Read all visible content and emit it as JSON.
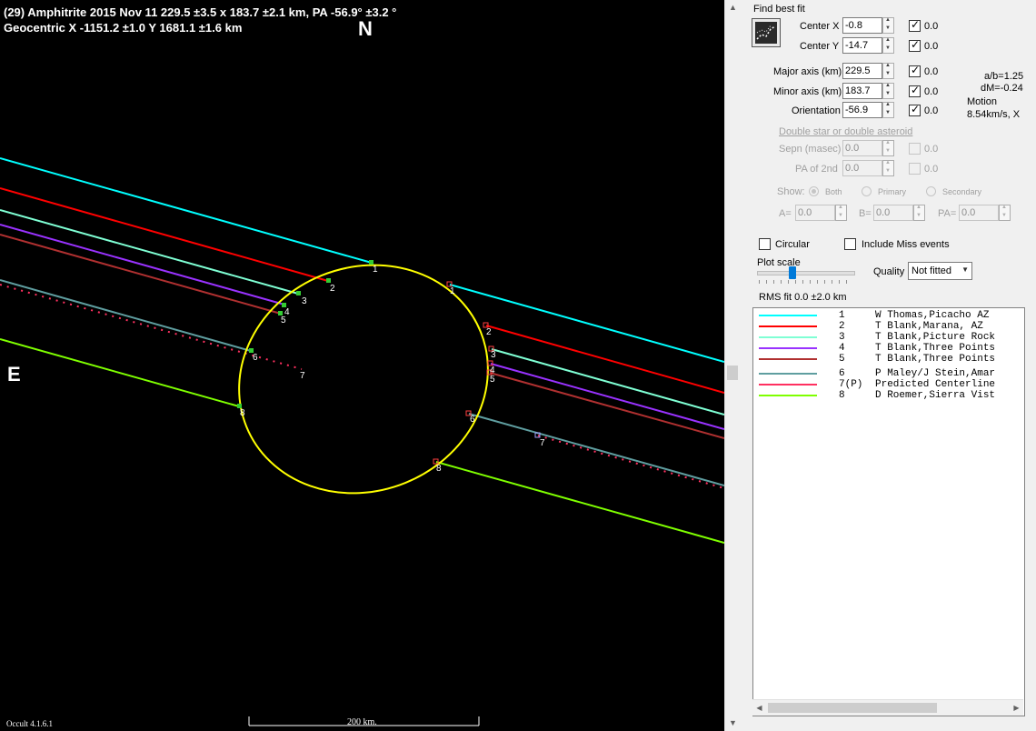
{
  "header": {
    "line1": "(29) Amphitrite  2015 Nov 11   229.5 ±3.5 x 183.7 ±2.1 km, PA -56.9° ±3.2 °",
    "line2": "Geocentric  X  -1151.2 ±1.0  Y 1681.1 ±1.6 km"
  },
  "plot": {
    "north_label": "N",
    "east_label": "E",
    "version": "Occult 4.1.6.1",
    "scale_label": "200 km.",
    "ellipse_color": "#ffff00",
    "chord_labels": [
      "1",
      "2",
      "3",
      "4",
      "5",
      "6",
      "7",
      "8"
    ]
  },
  "panel": {
    "find_best_fit": "Find best fit",
    "center_x": {
      "label": "Center X",
      "value": "-0.8",
      "check": "0.0"
    },
    "center_y": {
      "label": "Center Y",
      "value": "-14.7",
      "check": "0.0"
    },
    "major_axis": {
      "label": "Major axis (km)",
      "value": "229.5",
      "check": "0.0"
    },
    "minor_axis": {
      "label": "Minor axis (km)",
      "value": "183.7",
      "check": "0.0"
    },
    "orientation": {
      "label": "Orientation",
      "value": "-56.9",
      "check": "0.0"
    },
    "ab_ratio": "a/b=1.25",
    "dm": "dM=-0.24",
    "motion_label": "Motion",
    "motion_value": "8.54km/s, X",
    "double_star_link": "Double star  or  double asteroid",
    "sepn": {
      "label": "Sepn (masec)",
      "value": "0.0",
      "check": "0.0"
    },
    "pa2nd": {
      "label": "PA of 2nd",
      "value": "0.0",
      "check": "0.0"
    },
    "show_label": "Show:",
    "show_options": [
      "Both",
      "Primary",
      "Secondary"
    ],
    "a_label": "A=",
    "a_value": "0.0",
    "b_label": "B=",
    "b_value": "0.0",
    "pa_label": "PA=",
    "pa_value": "0.0",
    "circular": "Circular",
    "include_miss": "Include Miss events",
    "plot_scale": "Plot scale",
    "quality_label": "Quality",
    "quality_value": "Not fitted",
    "rms_fit": "RMS fit  0.0 ±2.0 km"
  },
  "legend": [
    {
      "no": "1",
      "name": "W Thomas,Picacho AZ",
      "color": "#00ffff"
    },
    {
      "no": "2",
      "name": "T Blank,Marana, AZ",
      "color": "#ff0000"
    },
    {
      "no": "3",
      "name": "T Blank,Picture Rock",
      "color": "#7fffd4"
    },
    {
      "no": "4",
      "name": "T Blank,Three Points",
      "color": "#9932ff"
    },
    {
      "no": "5",
      "name": "T Blank,Three Points",
      "color": "#b03030"
    },
    {
      "no": "6",
      "name": "P Maley/J Stein,Amar",
      "color": "#5f9ea0"
    },
    {
      "no": "7(P)",
      "name": "Predicted Centerline",
      "color": "#ff3060"
    },
    {
      "no": "8",
      "name": "D Roemer,Sierra Vist",
      "color": "#7fff00"
    }
  ]
}
